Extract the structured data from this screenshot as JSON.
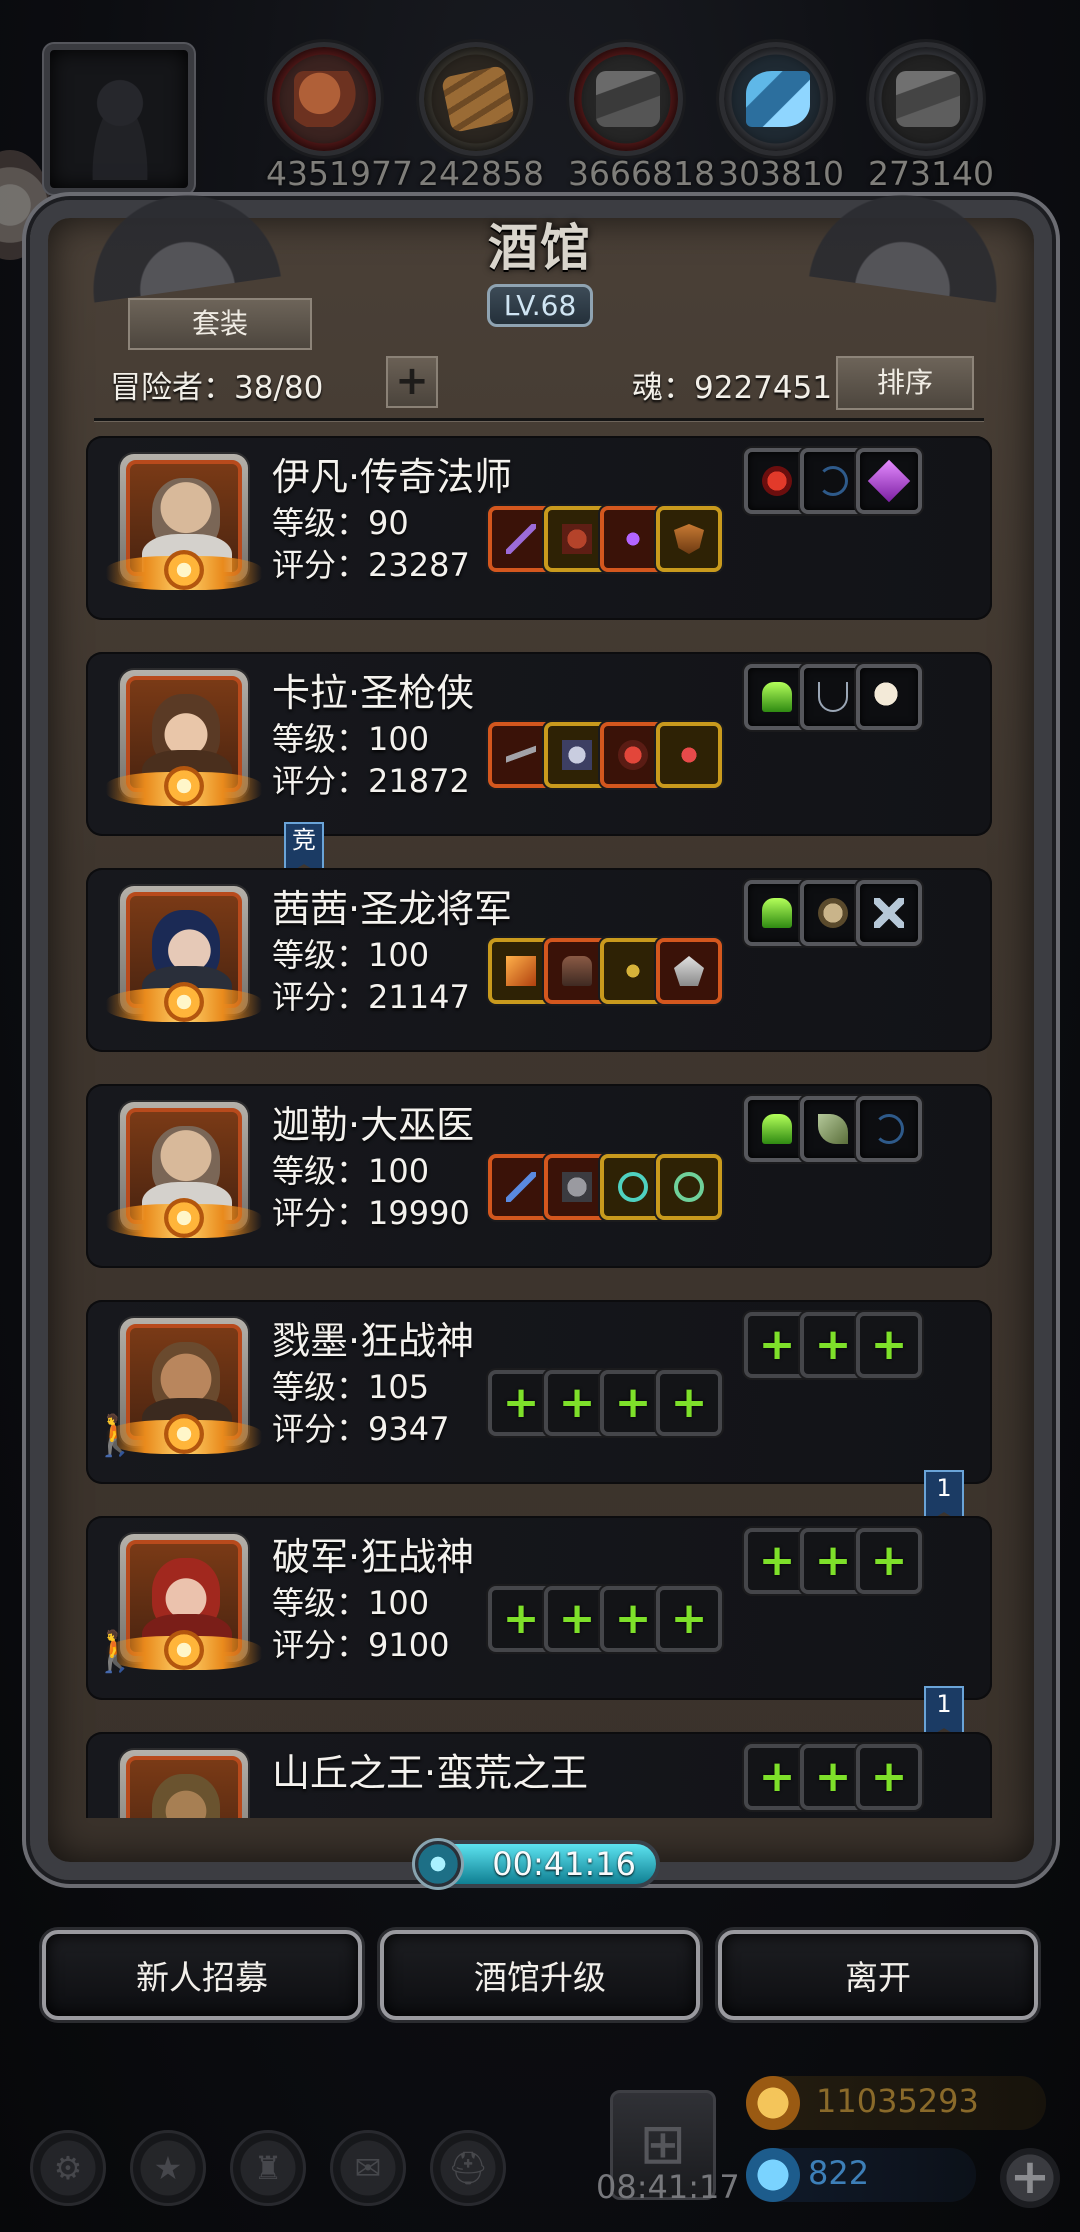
{
  "resources": [
    {
      "icon": "meat-icon",
      "value": "4351977"
    },
    {
      "icon": "wood-icon",
      "value": "242858"
    },
    {
      "icon": "iron-icon",
      "value": "3666818"
    },
    {
      "icon": "crystal-icon",
      "value": "303810"
    },
    {
      "icon": "stone-icon",
      "value": "273140"
    }
  ],
  "panel": {
    "title": "酒馆",
    "level": "LV.68",
    "set_tab": "套装",
    "adventurers": "冒险者：38/80",
    "add": "+",
    "soul": "魂：9227451",
    "sort": "排序"
  },
  "heroes": [
    {
      "name": "伊凡·传奇法师",
      "level": "等级：90",
      "score": "评分：23287"
    },
    {
      "name": "卡拉·圣枪侠",
      "level": "等级：100",
      "score": "评分：21872"
    },
    {
      "name": "茜茜·圣龙将军",
      "level": "等级：100",
      "score": "评分：21147"
    },
    {
      "name": "迦勒·大巫医",
      "level": "等级：100",
      "score": "评分：19990"
    },
    {
      "name": "戮墨·狂战神",
      "level": "等级：105",
      "score": "评分：9347"
    },
    {
      "name": "破军·狂战神",
      "level": "等级：100",
      "score": "评分：9100"
    },
    {
      "name": "山丘之王·蛮荒之王",
      "level": "",
      "score": ""
    }
  ],
  "badges": {
    "arena": "竞",
    "count_a": "1",
    "count_b": "1"
  },
  "slot_plus": "+",
  "timer": "00:41:16",
  "actions": {
    "recruit": "新人招募",
    "upgrade": "酒馆升级",
    "leave": "离开"
  },
  "bottom": {
    "clock": "08:41:17",
    "gold": "11035293",
    "diamond": "822",
    "add": "+"
  },
  "colors": {
    "slot_orange": "#d4571e",
    "slot_gold": "#c99a1d",
    "plus_green": "#7ee02a",
    "timer_cyan": "#5de3f0"
  }
}
